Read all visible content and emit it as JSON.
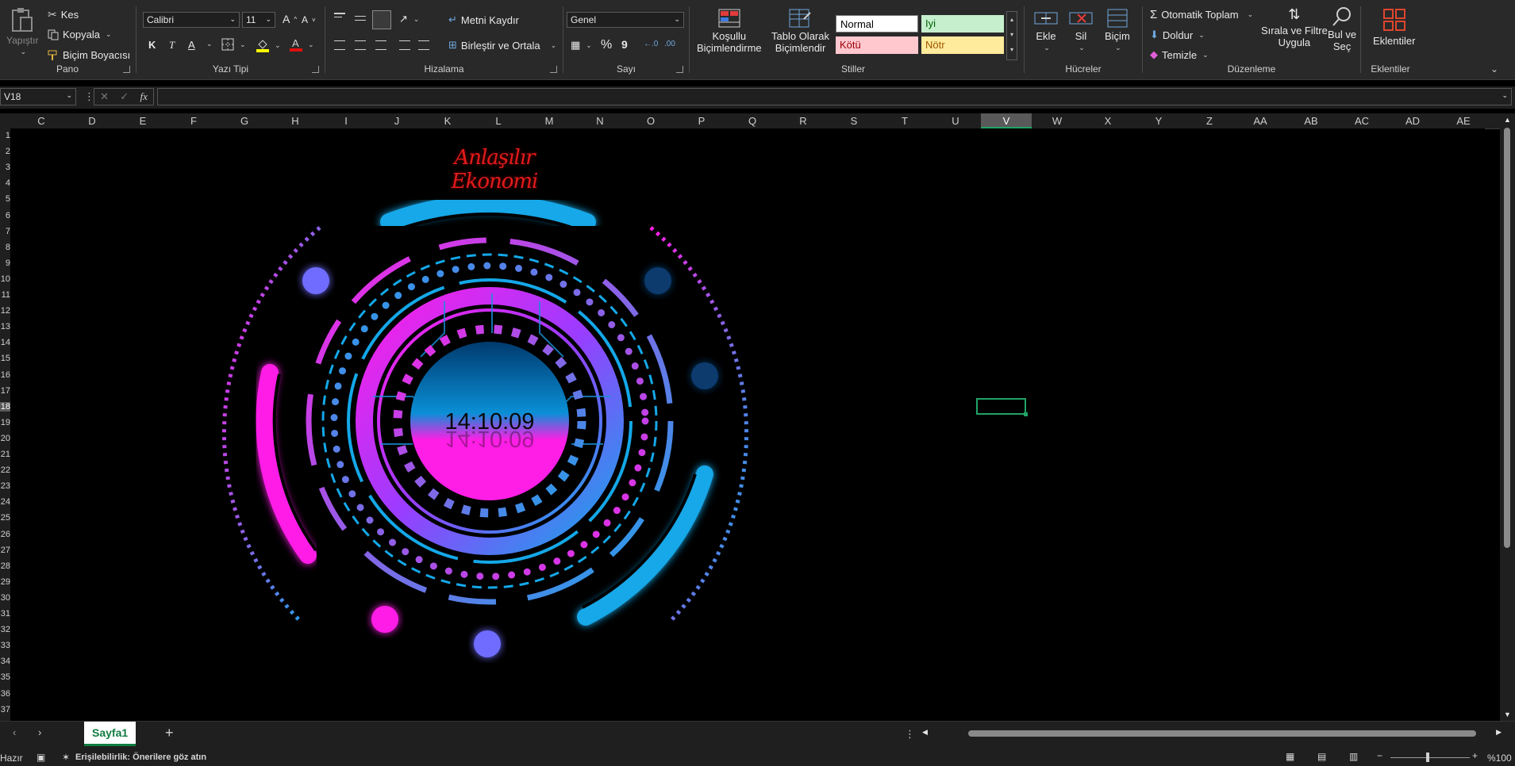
{
  "ribbon": {
    "clipboard": {
      "label": "Pano",
      "paste": "Yapıştır",
      "cut": "Kes",
      "copy": "Kopyala",
      "format_painter": "Biçim Boyacısı"
    },
    "font": {
      "label": "Yazı Tipi",
      "family": "Calibri",
      "size": "11",
      "bold": "K",
      "italic": "T",
      "underline": "A"
    },
    "alignment": {
      "label": "Hizalama",
      "wrap_text": "Metni Kaydır",
      "merge_center": "Birleştir ve Ortala"
    },
    "number": {
      "label": "Sayı",
      "format": "Genel",
      "percent": "%",
      "comma": "9"
    },
    "styles": {
      "label": "Stiller",
      "conditional": "Koşullu\nBiçimlendirme",
      "format_table": "Tablo Olarak\nBiçimlendir",
      "normal": "Normal",
      "good": "Iyi",
      "bad": "Kötü",
      "neutral": "Nötr"
    },
    "cells": {
      "label": "Hücreler",
      "insert": "Ekle",
      "delete": "Sil",
      "format": "Biçim"
    },
    "editing": {
      "label": "Düzenleme",
      "autosum": "Otomatik Toplam",
      "fill": "Doldur",
      "clear": "Temizle",
      "sort_filter": "Sırala ve Filtre\nUygula",
      "find_select": "Bul ve\nSeç"
    },
    "addins": {
      "label": "Eklentiler",
      "button": "Eklentiler"
    }
  },
  "formula_bar": {
    "name_box": "V18",
    "fx": "fx",
    "value": ""
  },
  "columns": [
    "C",
    "D",
    "E",
    "F",
    "G",
    "H",
    "I",
    "J",
    "K",
    "L",
    "M",
    "N",
    "O",
    "P",
    "Q",
    "R",
    "S",
    "T",
    "U",
    "V",
    "W",
    "X",
    "Y",
    "Z",
    "AA",
    "AB",
    "AC",
    "AD",
    "AE"
  ],
  "rows": [
    "1",
    "2",
    "3",
    "4",
    "5",
    "6",
    "7",
    "8",
    "9",
    "10",
    "11",
    "12",
    "13",
    "14",
    "15",
    "16",
    "17",
    "18",
    "19",
    "20",
    "21",
    "22",
    "23",
    "24",
    "25",
    "26",
    "27",
    "28",
    "29",
    "30",
    "31",
    "32",
    "33",
    "34",
    "35",
    "36",
    "37"
  ],
  "selected": {
    "column": "V",
    "row": "18"
  },
  "clock": {
    "brand": "Anlaşılır Ekonomi",
    "time": "14:10:09"
  },
  "sheets": {
    "active": "Sayfa1",
    "add": "+"
  },
  "status": {
    "ready": "Hazır",
    "accessibility": "Erişilebilirlik: Önerilere göz atın",
    "zoom": "%100"
  },
  "colors": {
    "accent_magenta": "#ff1ee6",
    "accent_cyan": "#14a8e8",
    "excel_green": "#107c41"
  }
}
